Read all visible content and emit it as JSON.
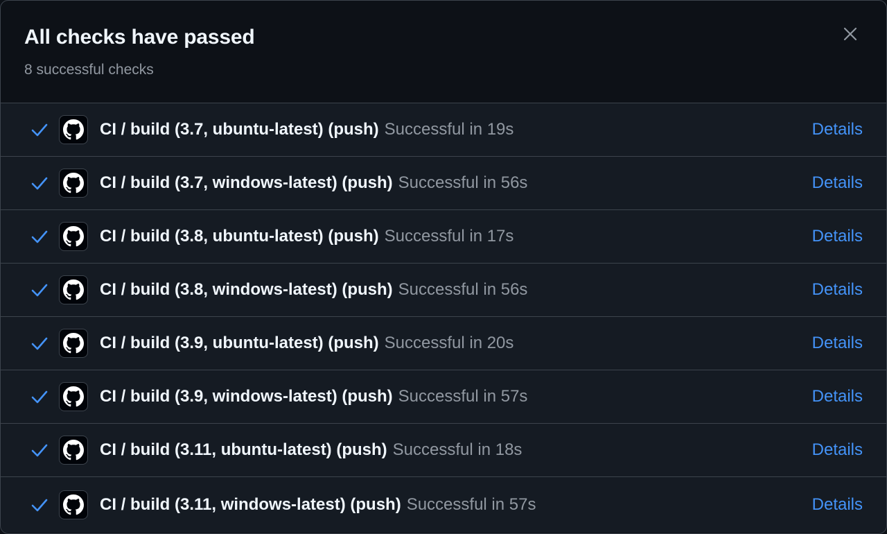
{
  "dialog": {
    "title": "All checks have passed",
    "subtitle": "8 successful checks",
    "close_icon": "x-icon"
  },
  "colors": {
    "background": "#0d1117",
    "row_background": "#151b23",
    "border": "#3d444d",
    "title": "#f0f6fc",
    "muted": "#9198a1",
    "link": "#4493f8",
    "check": "#4493f8"
  },
  "checks": [
    {
      "name": "CI / build (3.7, ubuntu-latest) (push)",
      "status": "Successful in 19s",
      "action": "Details",
      "icon": "check-icon",
      "avatar_icon": "github-icon"
    },
    {
      "name": "CI / build (3.7, windows-latest) (push)",
      "status": "Successful in 56s",
      "action": "Details",
      "icon": "check-icon",
      "avatar_icon": "github-icon"
    },
    {
      "name": "CI / build (3.8, ubuntu-latest) (push)",
      "status": "Successful in 17s",
      "action": "Details",
      "icon": "check-icon",
      "avatar_icon": "github-icon"
    },
    {
      "name": "CI / build (3.8, windows-latest) (push)",
      "status": "Successful in 56s",
      "action": "Details",
      "icon": "check-icon",
      "avatar_icon": "github-icon"
    },
    {
      "name": "CI / build (3.9, ubuntu-latest) (push)",
      "status": "Successful in 20s",
      "action": "Details",
      "icon": "check-icon",
      "avatar_icon": "github-icon"
    },
    {
      "name": "CI / build (3.9, windows-latest) (push)",
      "status": "Successful in 57s",
      "action": "Details",
      "icon": "check-icon",
      "avatar_icon": "github-icon"
    },
    {
      "name": "CI / build (3.11, ubuntu-latest) (push)",
      "status": "Successful in 18s",
      "action": "Details",
      "icon": "check-icon",
      "avatar_icon": "github-icon"
    },
    {
      "name": "CI / build (3.11, windows-latest) (push)",
      "status": "Successful in 57s",
      "action": "Details",
      "icon": "check-icon",
      "avatar_icon": "github-icon"
    }
  ]
}
